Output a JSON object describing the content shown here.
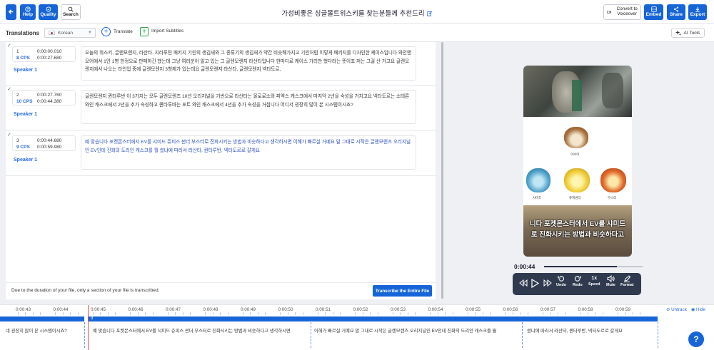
{
  "header": {
    "title": "가성비좋은 싱글몰트위스키를 찾는분들께 추천드리",
    "help_label": "Help",
    "quality_label": "Quality",
    "search_label": "Search",
    "voiceover_label": "Convert to Voiceover",
    "embed_label": "Embed",
    "share_label": "Share",
    "export_label": "Export"
  },
  "toolbar": {
    "section_title": "Translations",
    "language": "Korean",
    "translate_label": "Translate",
    "import_label": "Import Subtitles",
    "ai_tools_label": "AI Tools"
  },
  "segments": [
    {
      "number": "1",
      "cps": "8 CPS",
      "start": "0:00:00.010",
      "end": "0:00:27.680",
      "speaker": "Speaker 1",
      "text": "오늘의 위스키, 글렌모렌지, 라산타. 지라푸틴 패키지 기린의 생김새와 그 종류기의 생김새가 약간 비슷해가지고 기린처럼 이렇게 패키지를 디자인한 케이스입니다 와인앤모어에서 1인 1병 한정으로 판매하긴 했는데 그냥 여러분이 알고 있는 그 글렌모렌지 라산타입니다 한마디로 케이스 가리만 했다라는 뜻이죠 저는 그걸 산 거고요 글렌모렌지에서 나오는 라인업 중에 글렌모렌지 3형제가 있는데요 글렌모렌지 라산타, 글렌모렌지 넥타도르,"
    },
    {
      "number": "2",
      "cps": "10 CPS",
      "start": "0:00:27.760",
      "end": "0:00:44.380",
      "speaker": "Speaker 1",
      "text": "글렌모렌지 퀸타루반 이 3가지는 모두 글렌모렌즈 10년 오리지널을 기반으로 라산타는 올로로소와 피엑스 캐스크에서 마지막 2년을 숙성을 거치고요 넥타도르는 소테른 와인 캐스크에서 2년을 추가 숙성하고 퀸타루바는 포트 와인 캐스크에서 4년을 추가 숙성을 거칩니다 어디서 굉장히 많이 본 시스템이시죠?"
    },
    {
      "number": "3",
      "cps": "9 CPS",
      "start": "0:00:44.680",
      "end": "0:00:59.980",
      "speaker": "Speaker 1",
      "text": "예 맞습니다 포켓몬스터에서 EV를 샤미드 쥬피스 썬더 부스터로 진화시키는 방법과 비슷하다고 생각하시면 이해가 빠르실 거예요 말 그대로 시작은 글렌모렌즈 오리지널인 EV인데 진화의 도리인 캐스크를 뭘 썼냐에 따라서 라산타, 퀸타루반, 넥타도르로 갈게요"
    }
  ],
  "notice": {
    "message": "Due to the duration of your file, only a section of your file is transcribed.",
    "button_label": "Transcribe the Entire File"
  },
  "player": {
    "subtitle_line1": "니다 포켓몬스터에서 EV를 샤미드",
    "subtitle_line2": "로 진화시키는 방법과 비슷하다고",
    "current_time": "0:00:44",
    "progress": 0.74,
    "pokemon_names": [
      "이브이",
      "샤미드",
      "쥬피썬더",
      "부스터"
    ],
    "undo_label": "Undo",
    "redo_label": "Redo",
    "speed_value": "1x",
    "speed_label": "Speed",
    "mute_label": "Mute",
    "format_label": "Format"
  },
  "timeline": {
    "ticks": [
      "0:00:43",
      "0:00:44",
      "0:00:45",
      "0:00:46",
      "0:00:47",
      "0:00:48",
      "0:00:49",
      "0:00:50",
      "0:00:51",
      "0:00:52",
      "0:00:53",
      "0:00:54",
      "0:00:55",
      "0:00:56",
      "0:00:57",
      "0:00:58",
      "0:00:59"
    ],
    "untrack_label": "Untrack",
    "hide_label": "Hide",
    "segment_number": "3",
    "clips": [
      "네 굉장히 많이 본 시스템이시죠?",
      "예 맞습니다 포켓몬스터에서 EV를 샤미드 쥬피스 썬더 부스터로 진화시키는 방법과 비슷하다고 생각하시면",
      "이해가 빠르실 거예요 말 그대로 시작은 글렌모렌즈 오리지널인 EV인데 진화의 도리인 캐스크를 뭘",
      "썼냐에 따라서 라산타, 퀸타루반, 넥타도르로 갈게요"
    ]
  },
  "help_fab": "?",
  "colors": {
    "accent": "#1565d8",
    "cps_blue": "#2a6be0",
    "controls_bg": "#2f3a4f"
  }
}
